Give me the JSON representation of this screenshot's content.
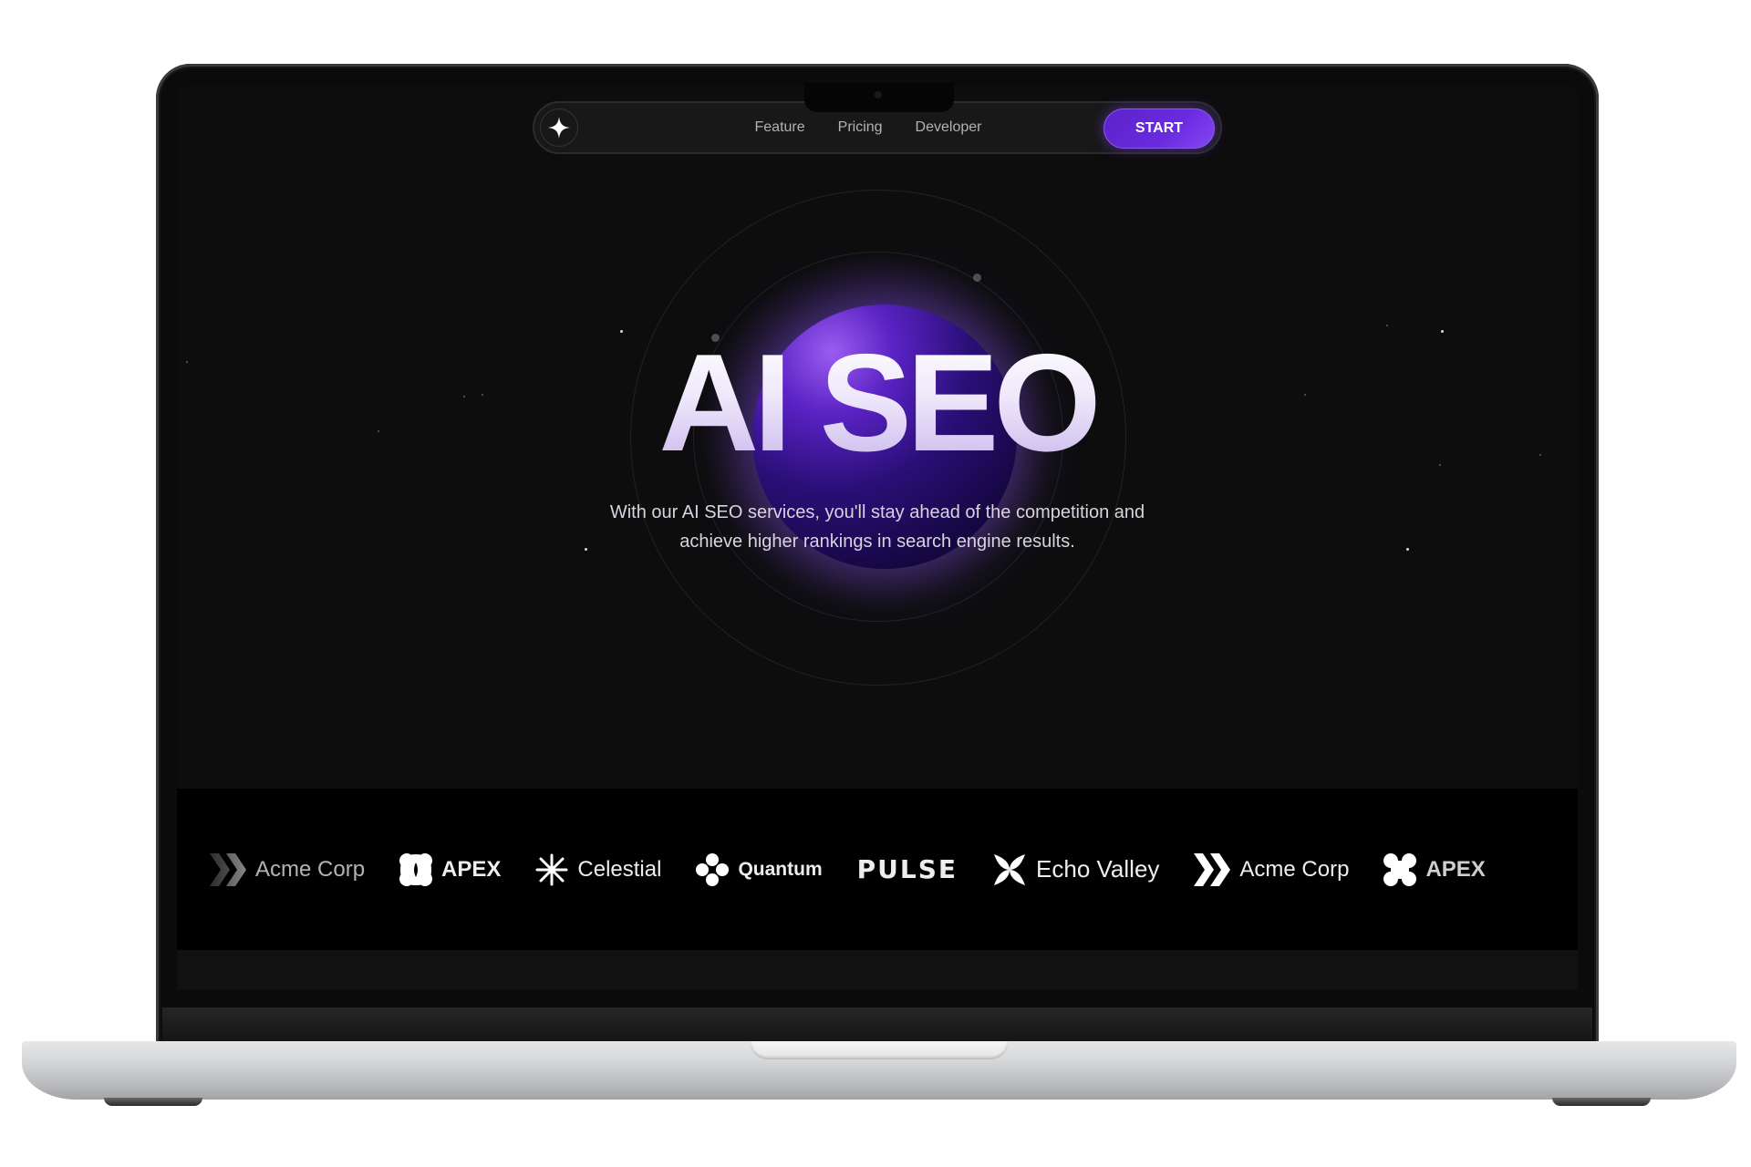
{
  "nav": {
    "logo_icon": "four-point-star-icon",
    "links": [
      {
        "label": "Feature"
      },
      {
        "label": "Pricing"
      },
      {
        "label": "Developer"
      }
    ],
    "cta_label": "START"
  },
  "hero": {
    "title": "AI SEO",
    "subtitle_line1": "With our AI SEO services, you'll stay ahead of the competition and",
    "subtitle_line2": "achieve higher rankings in search engine results."
  },
  "logos": [
    {
      "name": "Acme Corp",
      "icon": "double-chevron-icon"
    },
    {
      "name": "APEX",
      "icon": "quatrefoil-icon"
    },
    {
      "name": "Celestial",
      "icon": "asterisk-burst-icon"
    },
    {
      "name": "Quantum",
      "icon": "four-dot-clover-icon"
    },
    {
      "name": "PULSE",
      "icon": "wordmark"
    },
    {
      "name": "Echo Valley",
      "icon": "x-petals-icon"
    },
    {
      "name": "Acme Corp",
      "icon": "double-chevron-icon"
    },
    {
      "name": "APEX",
      "icon": "quatrefoil-icon"
    }
  ],
  "colors": {
    "accent": "#6a2be0",
    "background": "#0d0d0e",
    "orb": "#2a0f78"
  }
}
